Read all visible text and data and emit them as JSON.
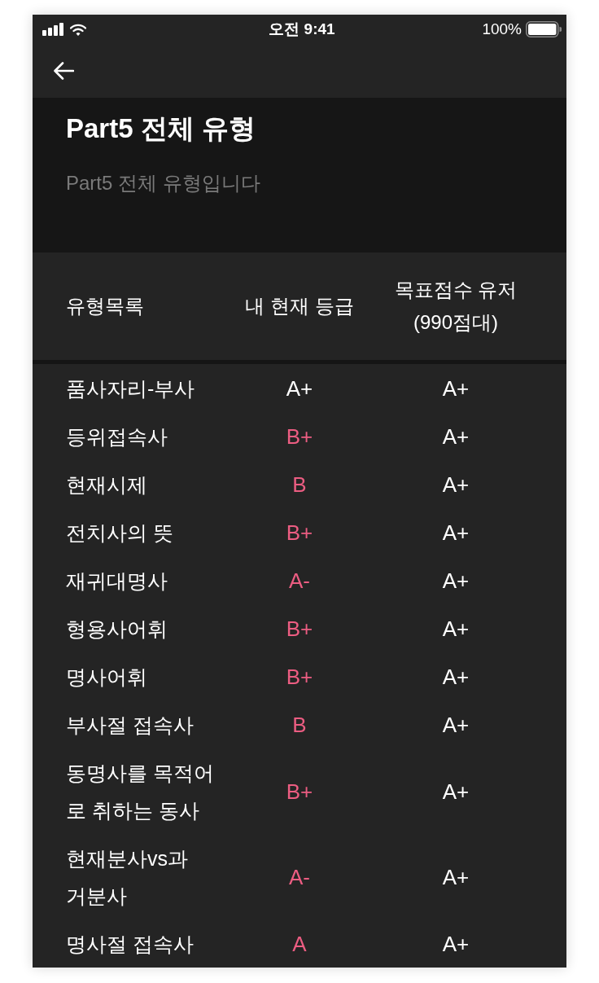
{
  "status_bar": {
    "time": "오전 9:41",
    "battery": "100%"
  },
  "header": {
    "title": "Part5 전체 유형",
    "subtitle": "Part5 전체 유형입니다"
  },
  "table": {
    "columns": [
      "유형목록",
      "내 현재 등급",
      "목표점수 유저\n(990점대)"
    ],
    "rows": [
      {
        "name": "품사자리-부사",
        "current": {
          "grade": "A+",
          "color": "#ffffff"
        },
        "target": "A+"
      },
      {
        "name": "등위접속사",
        "current": {
          "grade": "B+",
          "color": "#ec5d82"
        },
        "target": "A+"
      },
      {
        "name": "현재시제",
        "current": {
          "grade": "B",
          "color": "#ec5d82"
        },
        "target": "A+"
      },
      {
        "name": "전치사의 뜻",
        "current": {
          "grade": "B+",
          "color": "#ec5d82"
        },
        "target": "A+"
      },
      {
        "name": "재귀대명사",
        "current": {
          "grade": "A-",
          "color": "#ec5d82"
        },
        "target": "A+"
      },
      {
        "name": "형용사어휘",
        "current": {
          "grade": "B+",
          "color": "#ec5d82"
        },
        "target": "A+"
      },
      {
        "name": "명사어휘",
        "current": {
          "grade": "B+",
          "color": "#ec5d82"
        },
        "target": "A+"
      },
      {
        "name": "부사절 접속사",
        "current": {
          "grade": "B",
          "color": "#ec5d82"
        },
        "target": "A+"
      },
      {
        "name": "동명사를 목적어\n로 취하는 동사",
        "current": {
          "grade": "B+",
          "color": "#ec5d82"
        },
        "target": "A+"
      },
      {
        "name": "현재분사vs과\n거분사",
        "current": {
          "grade": "A-",
          "color": "#ec5d82"
        },
        "target": "A+"
      },
      {
        "name": "명사절 접속사",
        "current": {
          "grade": "A",
          "color": "#ec5d82"
        },
        "target": "A+"
      }
    ]
  }
}
